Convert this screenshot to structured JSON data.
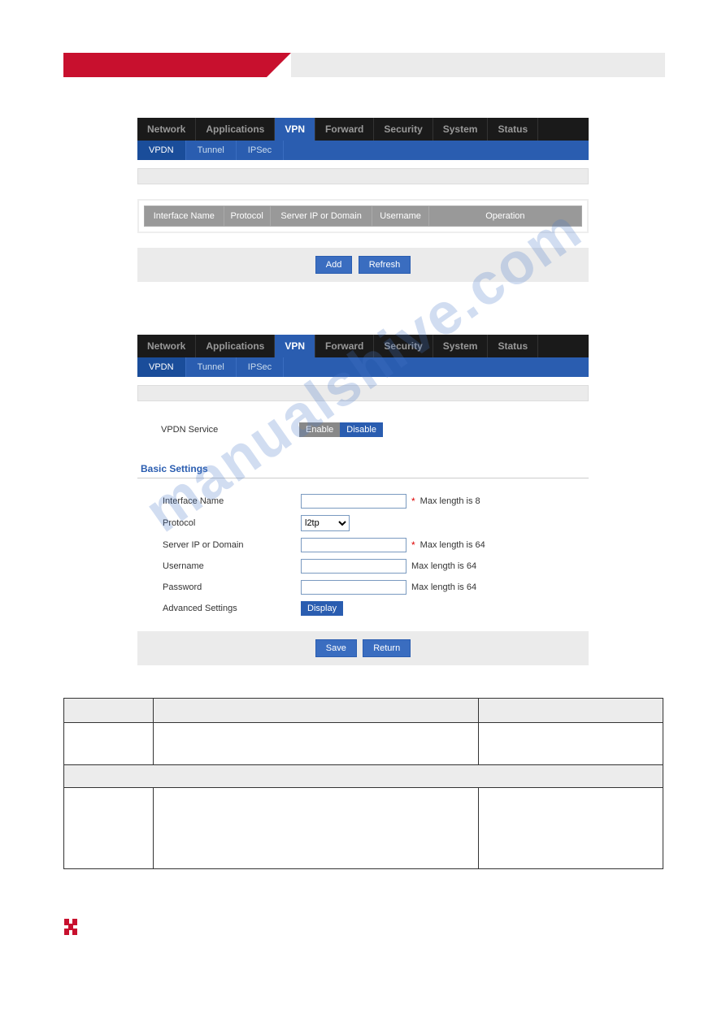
{
  "watermark": "manualshive.com",
  "panel1": {
    "main_tabs": [
      "Network",
      "Applications",
      "VPN",
      "Forward",
      "Security",
      "System",
      "Status"
    ],
    "main_active_index": 2,
    "sub_tabs": [
      "VPDN",
      "Tunnel",
      "IPSec"
    ],
    "sub_active_index": 0,
    "table_headers": [
      "Interface Name",
      "Protocol",
      "Server IP or Domain",
      "Username",
      "Operation"
    ],
    "btn_add": "Add",
    "btn_refresh": "Refresh"
  },
  "panel2": {
    "main_tabs": [
      "Network",
      "Applications",
      "VPN",
      "Forward",
      "Security",
      "System",
      "Status"
    ],
    "main_active_index": 2,
    "sub_tabs": [
      "VPDN",
      "Tunnel",
      "IPSec"
    ],
    "sub_active_index": 0,
    "vpdn_service_label": "VPDN Service",
    "enable_label": "Enable",
    "disable_label": "Disable",
    "section_title": "Basic Settings",
    "fields": {
      "interface_name": {
        "label": "Interface Name",
        "hint": "Max length is 8",
        "required": true,
        "value": ""
      },
      "protocol": {
        "label": "Protocol",
        "value": "l2tp",
        "options": [
          "l2tp"
        ]
      },
      "server": {
        "label": "Server IP or Domain",
        "hint": "Max length is 64",
        "required": true,
        "value": ""
      },
      "username": {
        "label": "Username",
        "hint": "Max length is 64",
        "required": false,
        "value": ""
      },
      "password": {
        "label": "Password",
        "hint": "Max length is 64",
        "required": false,
        "value": ""
      },
      "advanced": {
        "label": "Advanced Settings",
        "button": "Display"
      }
    },
    "btn_save": "Save",
    "btn_return": "Return"
  }
}
